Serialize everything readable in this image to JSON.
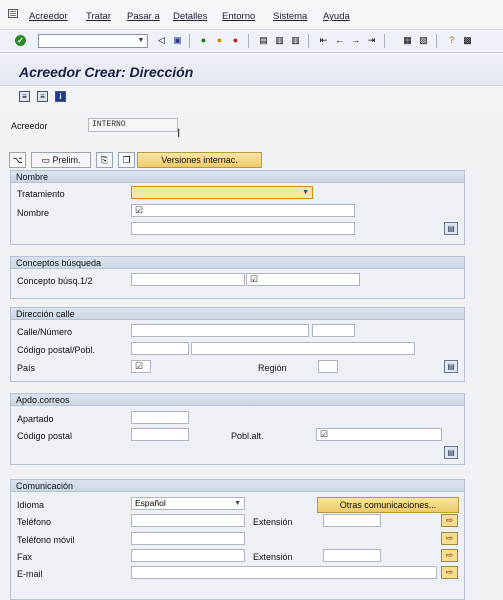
{
  "menu": {
    "items": [
      "Acreedor",
      "Tratar",
      "Pasar a",
      "Detalles",
      "Entorno",
      "Sistema",
      "Ayuda"
    ]
  },
  "toolbar": {
    "command_field": "",
    "icons": [
      "enter-icon",
      "back-icon",
      "save-icon",
      "back-nav-icon",
      "exit-icon",
      "cancel-icon",
      "print-icon",
      "find-icon",
      "find-next-icon",
      "first-page-icon",
      "prev-page-icon",
      "next-page-icon",
      "last-page-icon",
      "new-session-icon",
      "shortcut-icon",
      "help-icon",
      "layout-icon"
    ]
  },
  "page": {
    "title": "Acreedor Crear: Dirección"
  },
  "vendor": {
    "label": "Acreedor",
    "value": "INTERNO"
  },
  "buttons": {
    "preview": "Prelim.",
    "intl_versions": "Versiones internac."
  },
  "sections": {
    "name": {
      "title": "Nombre",
      "salutation_label": "Tratamiento",
      "salutation_value": "",
      "name_label": "Nombre"
    },
    "search_terms": {
      "title": "Conceptos búsqueda",
      "term_label": "Concepto búsq.1/2"
    },
    "street": {
      "title": "Dirección calle",
      "street_label": "Calle/Número",
      "postal_label": "Código postal/Pobl.",
      "country_label": "País",
      "region_label": "Región"
    },
    "po_box": {
      "title": "Apdo.correos",
      "po_box_label": "Apartado",
      "postal_label": "Código postal",
      "other_city_label": "Pobl.alt."
    },
    "communication": {
      "title": "Comunicación",
      "language_label": "Idioma",
      "language_value": "Español",
      "other_comm_button": "Otras comunicaciones...",
      "phone_label": "Teléfono",
      "extension_label": "Extensión",
      "mobile_label": "Teléfono móvil",
      "fax_label": "Fax",
      "fax_extension_label": "Extensión",
      "email_label": "E-mail"
    }
  },
  "colors": {
    "required_field": "#fbe6a1",
    "group_header": "#ccd6e4",
    "title_text": "#1b1f44"
  }
}
